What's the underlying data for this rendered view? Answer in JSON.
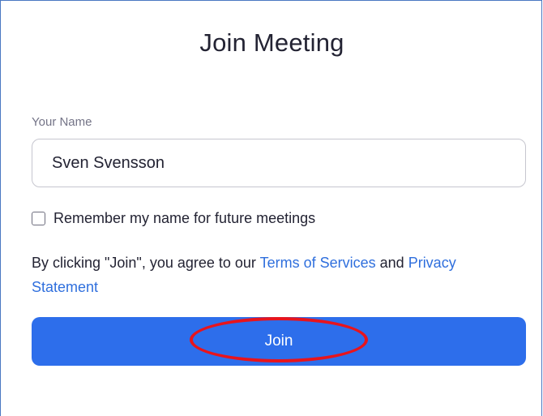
{
  "dialog": {
    "title": "Join Meeting",
    "name_label": "Your Name",
    "name_value": "Sven Svensson",
    "remember_label": "Remember my name for future meetings",
    "remember_checked": false,
    "agree_prefix": "By clicking \"Join\", you agree to our ",
    "terms_link": "Terms of Services",
    "agree_and": " and ",
    "privacy_link": "Privacy Statement",
    "join_label": "Join"
  },
  "colors": {
    "accent": "#2d6eeb",
    "link": "#2f6fdd",
    "highlight": "#e8141c",
    "frame_border": "#4a78c2"
  }
}
